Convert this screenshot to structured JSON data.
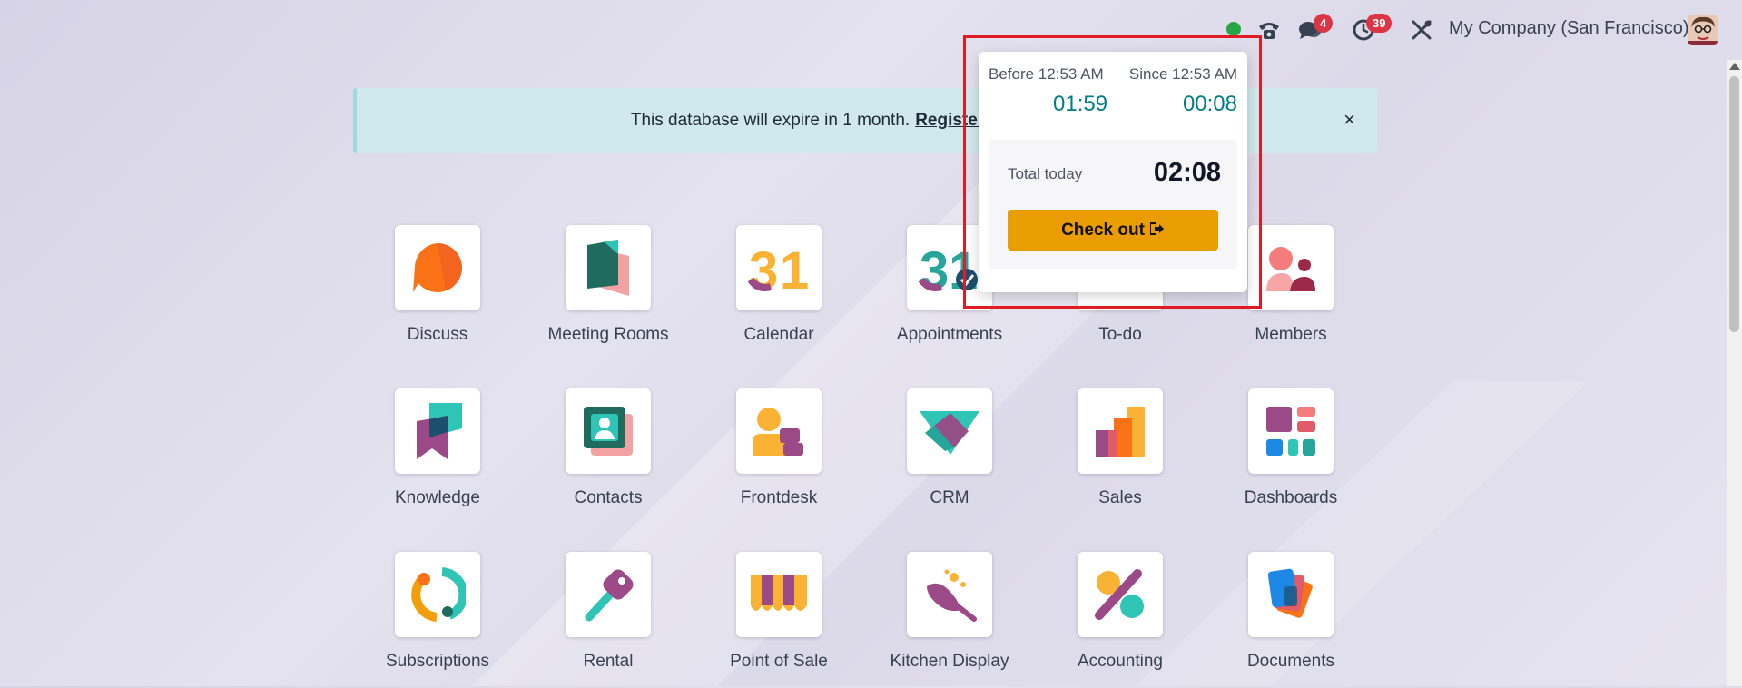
{
  "topbar": {
    "messages_count": "4",
    "activities_count": "39",
    "company": "My Company (San Francisco)"
  },
  "banner": {
    "text": "This database will expire in 1 month.",
    "link": "Register your subscrip",
    "close": "×"
  },
  "apps": [
    {
      "label": "Discuss",
      "icon": "discuss-icon"
    },
    {
      "label": "Meeting Rooms",
      "icon": "meeting-rooms-icon"
    },
    {
      "label": "Calendar",
      "icon": "calendar-icon"
    },
    {
      "label": "Appointments",
      "icon": "appointments-icon"
    },
    {
      "label": "To-do",
      "icon": "todo-icon"
    },
    {
      "label": "Members",
      "icon": "members-icon"
    },
    {
      "label": "Knowledge",
      "icon": "knowledge-icon"
    },
    {
      "label": "Contacts",
      "icon": "contacts-icon"
    },
    {
      "label": "Frontdesk",
      "icon": "frontdesk-icon"
    },
    {
      "label": "CRM",
      "icon": "crm-icon"
    },
    {
      "label": "Sales",
      "icon": "sales-icon"
    },
    {
      "label": "Dashboards",
      "icon": "dashboards-icon"
    },
    {
      "label": "Subscriptions",
      "icon": "subscriptions-icon"
    },
    {
      "label": "Rental",
      "icon": "rental-icon"
    },
    {
      "label": "Point of Sale",
      "icon": "point-of-sale-icon"
    },
    {
      "label": "Kitchen Display",
      "icon": "kitchen-display-icon"
    },
    {
      "label": "Accounting",
      "icon": "accounting-icon"
    },
    {
      "label": "Documents",
      "icon": "documents-icon"
    }
  ],
  "attendance": {
    "before_label": "Before 12:53 AM",
    "since_label": "Since 12:53 AM",
    "before_value": "01:59",
    "since_value": "00:08",
    "total_label": "Total today",
    "total_value": "02:08",
    "checkout_label": "Check out"
  },
  "colors": {
    "accent_teal": "#017e84",
    "checkout": "#e99d00",
    "badge": "#dc3545",
    "highlight": "#e01b24"
  }
}
